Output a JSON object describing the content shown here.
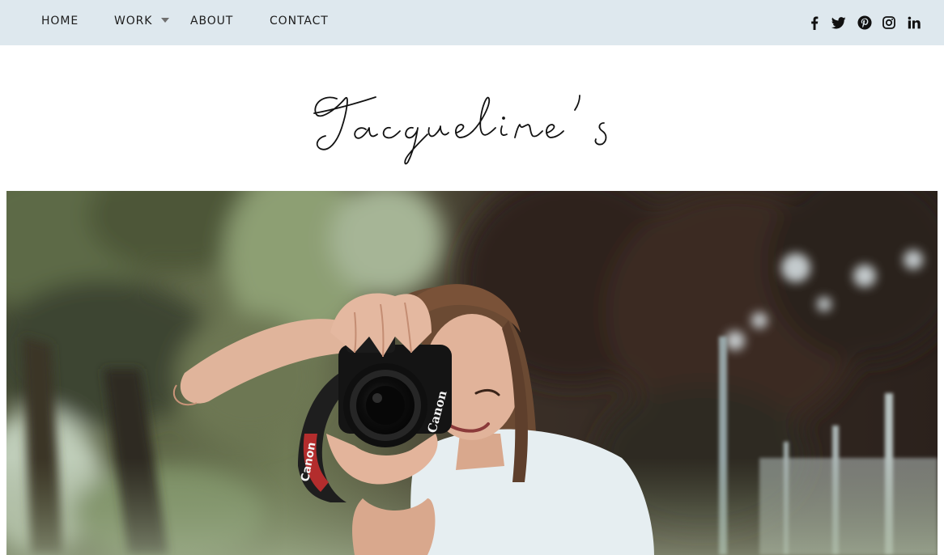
{
  "nav": {
    "items": [
      {
        "label": "HOME"
      },
      {
        "label": "WORK",
        "has_dropdown": true
      },
      {
        "label": "ABOUT"
      },
      {
        "label": "CONTACT"
      }
    ]
  },
  "social": [
    {
      "icon": "facebook-icon"
    },
    {
      "icon": "twitter-icon"
    },
    {
      "icon": "pinterest-icon"
    },
    {
      "icon": "instagram-icon"
    },
    {
      "icon": "linkedin-icon"
    }
  ],
  "logo": {
    "text": "Jacqueline's"
  },
  "hero": {
    "camera_brand": "Canon",
    "strap_text": "Canon"
  },
  "colors": {
    "topbar_bg": "#dee8ee",
    "nav_text": "#1c1c1c",
    "icon": "#111111",
    "page_bg": "#ffffff"
  }
}
